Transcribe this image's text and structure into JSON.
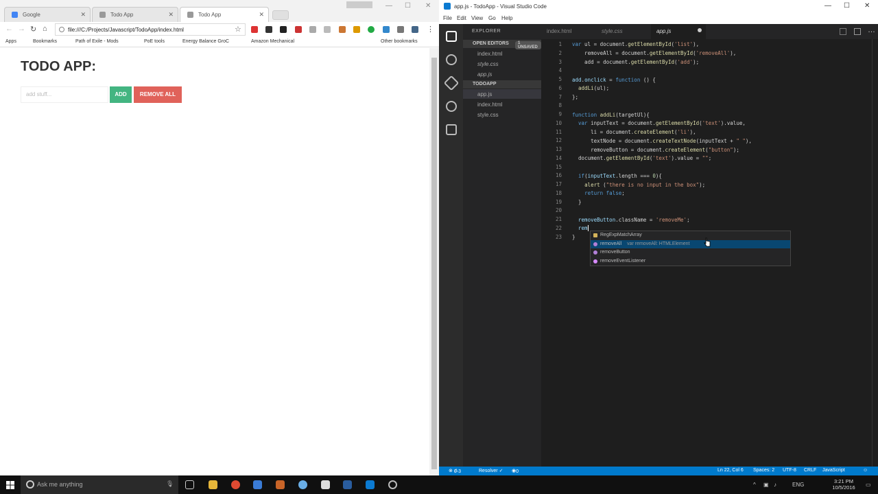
{
  "browser": {
    "tabs": [
      {
        "label": "Google"
      },
      {
        "label": "Todo App"
      },
      {
        "label": "Todo App"
      }
    ],
    "url": "file:///C:/Projects/Javascript/TodoApp/index.html",
    "bookmarks": [
      "Apps",
      "Bookmarks",
      "Path of Exile - Mods",
      "PoE tools",
      "Energy Balance GroC",
      "Amazon Mechanical",
      "Other bookmarks"
    ],
    "page": {
      "title": "TODO APP:",
      "input_placeholder": "add stuff...",
      "add_label": "ADD",
      "remove_label": "REMOVE ALL"
    },
    "window_controls": [
      "—",
      "☐",
      "✕"
    ]
  },
  "vscode": {
    "window_title": "app.js - TodoApp - Visual Studio Code",
    "menu": [
      "File",
      "Edit",
      "View",
      "Go",
      "Help"
    ],
    "explorer_header": "EXPLORER",
    "open_editors_label": "OPEN EDITORS",
    "unsaved_badge": "1 UNSAVED",
    "open_editors": [
      "index.html",
      "style.css",
      "app.js"
    ],
    "project_label": "TODOAPP",
    "project_files": [
      "app.js",
      "index.html",
      "style.css"
    ],
    "tabs": [
      "index.html",
      "style.css",
      "app.js"
    ],
    "line_numbers": [
      "1",
      "2",
      "3",
      "4",
      "5",
      "6",
      "7",
      "8",
      "9",
      "10",
      "11",
      "12",
      "13",
      "14",
      "15",
      "16",
      "17",
      "18",
      "19",
      "20",
      "21",
      "22",
      "23"
    ],
    "suggestions": [
      {
        "label": "RegExpMatchArray",
        "detail": ""
      },
      {
        "label": "removeAll",
        "detail": "var removeAll: HTMLElement"
      },
      {
        "label": "removeButton",
        "detail": ""
      },
      {
        "label": "removeEventListener",
        "detail": ""
      }
    ],
    "status": {
      "errors": "0",
      "warnings": "3",
      "resolver": "Resolver ✓",
      "info": "0",
      "position": "Ln 22, Col 6",
      "spaces": "Spaces: 2",
      "encoding": "UTF-8",
      "eol": "CRLF",
      "language": "JavaScript"
    }
  },
  "taskbar": {
    "search_placeholder": "Ask me anything",
    "language": "ENG",
    "time": "3:21 PM",
    "date": "10/5/2016"
  }
}
